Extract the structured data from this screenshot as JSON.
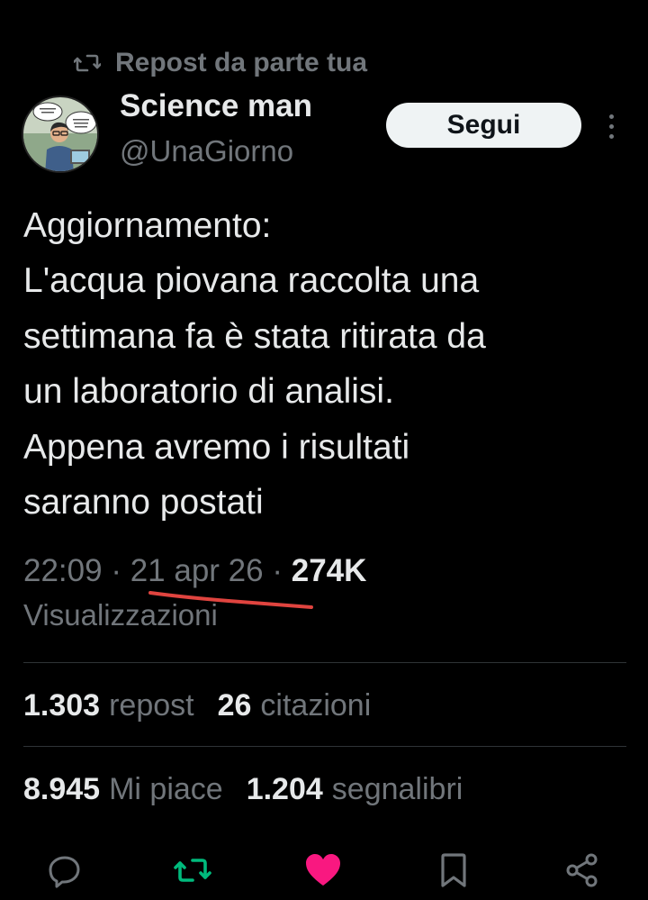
{
  "repost": {
    "label": "Repost da parte tua"
  },
  "author": {
    "name": "Science man",
    "handle": "@UnaGiorno"
  },
  "follow_label": "Segui",
  "tweet": {
    "lines": [
      "Aggiornamento:",
      "L'acqua piovana raccolta una",
      "settimana fa è stata ritirata da",
      "un laboratorio di analisi.",
      "Appena avremo i risultati",
      "saranno postati"
    ]
  },
  "meta": {
    "time": "22:09",
    "separator": "·",
    "date": "21 apr 26",
    "views_count": "274K",
    "views_label": "Visualizzazioni"
  },
  "stats": {
    "reposts": {
      "count": "1.303",
      "label": "repost"
    },
    "quotes": {
      "count": "26",
      "label": "citazioni"
    },
    "likes": {
      "count": "8.945",
      "label": "Mi piace"
    },
    "bookmarks": {
      "count": "1.204",
      "label": "segnalibri"
    }
  },
  "icons": {
    "reply": "reply-icon",
    "repost": "repost-icon",
    "like": "heart-icon",
    "bookmark": "bookmark-icon",
    "share": "share-icon"
  },
  "colors": {
    "background": "#000000",
    "text_primary": "#e7e9ea",
    "text_secondary": "#71767b",
    "repost_active": "#00ba7c",
    "like_active": "#f91880",
    "annotation_underline": "#e0443f"
  }
}
